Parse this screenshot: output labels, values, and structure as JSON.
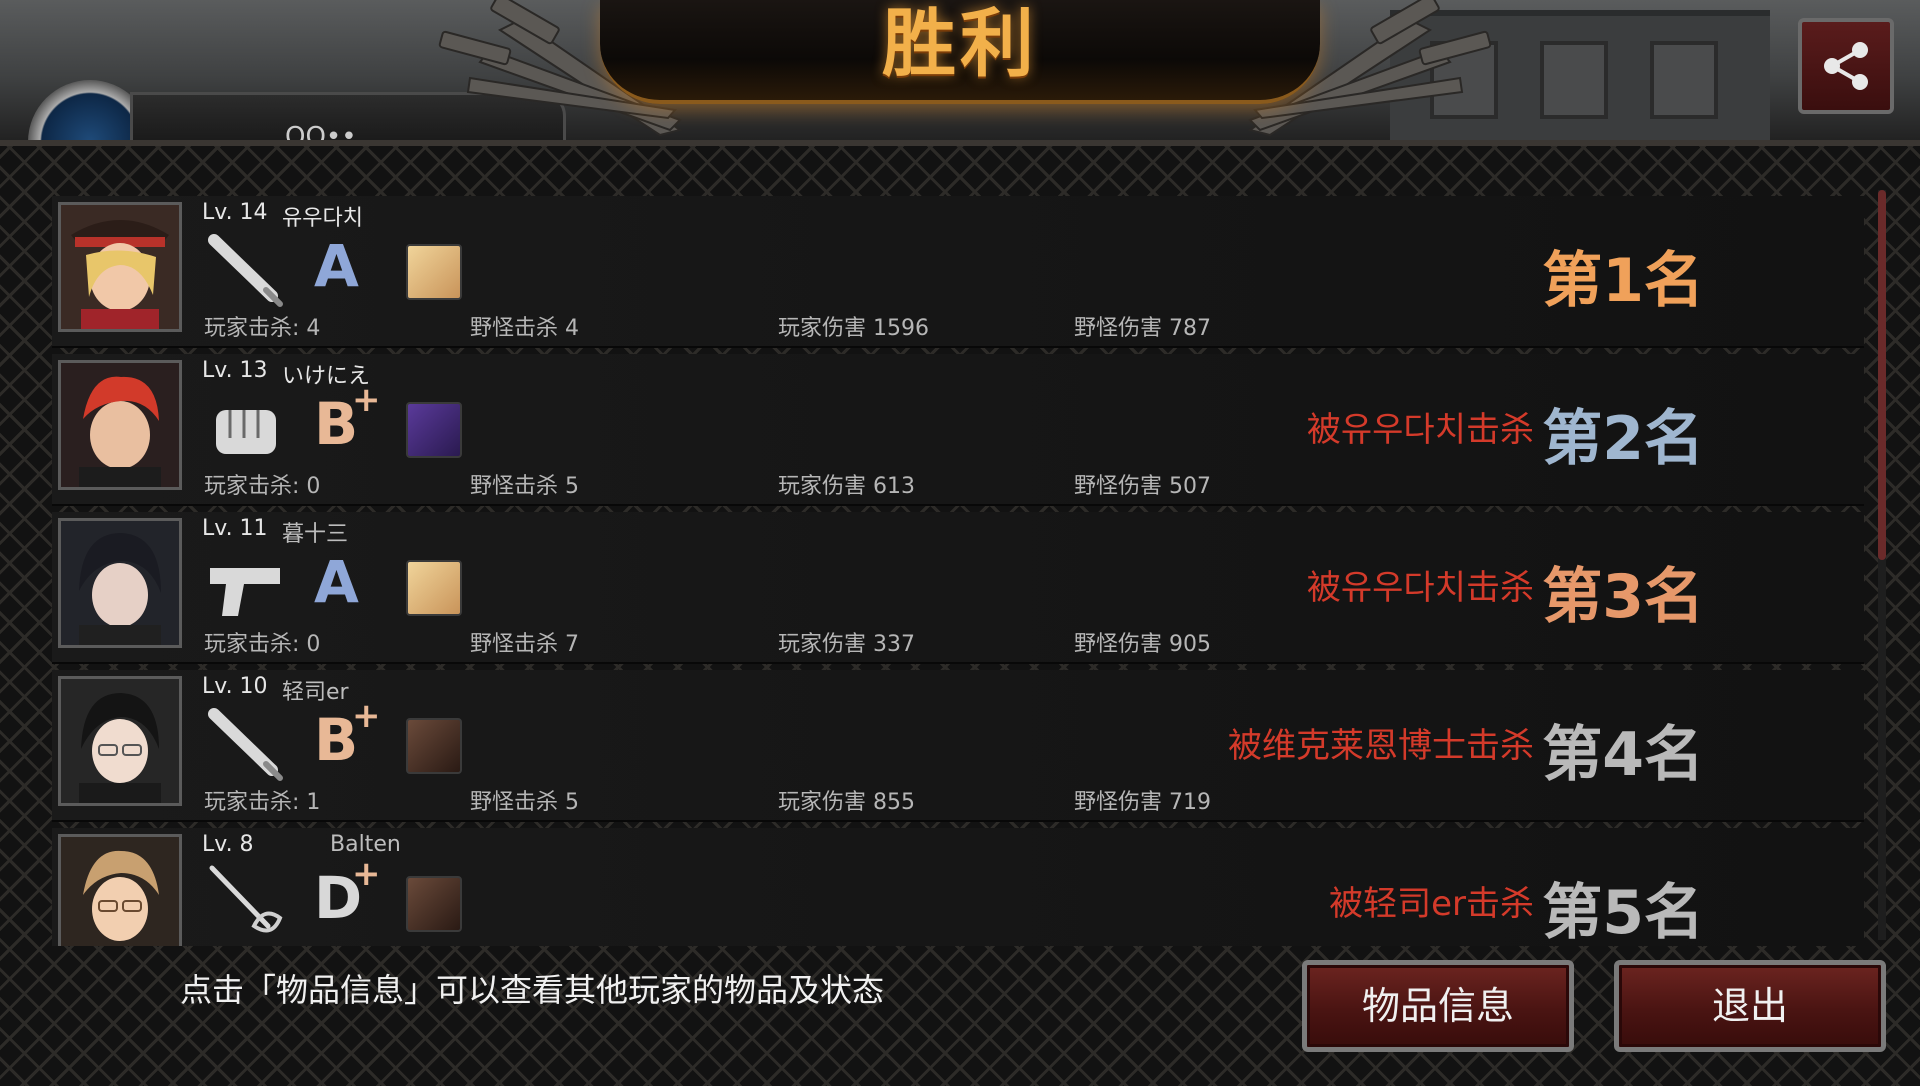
{
  "header": {
    "title": "胜利",
    "profile_name": "OO••"
  },
  "players": [
    {
      "level": "Lv. 14",
      "name": "유우다치",
      "weapon_icon": "bat-icon",
      "grade": "A",
      "grade_plus": "",
      "grade_color": "#8fa7d8",
      "item_icon": "crate-icon",
      "stats": {
        "player_kills": "玩家击杀: 4",
        "monster_kills": "野怪击杀 4",
        "player_damage": "玩家伤害 1596",
        "monster_damage": "野怪伤害 787"
      },
      "killed_by": "",
      "rank": "第1名",
      "rank_color": "#f0a15a"
    },
    {
      "level": "Lv. 13",
      "name": "いけにえ",
      "weapon_icon": "fist-icon",
      "grade": "B",
      "grade_plus": "+",
      "grade_color": "#e8b896",
      "item_icon": "purple-gear-icon",
      "stats": {
        "player_kills": "玩家击杀: 0",
        "monster_kills": "野怪击杀 5",
        "player_damage": "玩家伤害 613",
        "monster_damage": "野怪伤害 507"
      },
      "killed_by": "被유우다치击杀",
      "rank": "第2名",
      "rank_color": "#9fb6cf"
    },
    {
      "level": "Lv. 11",
      "name": "暮十三",
      "weapon_icon": "pistol-icon",
      "grade": "A",
      "grade_plus": "",
      "grade_color": "#8fa7d8",
      "item_icon": "crate-icon",
      "stats": {
        "player_kills": "玩家击杀: 0",
        "monster_kills": "野怪击杀 7",
        "player_damage": "玩家伤害 337",
        "monster_damage": "野怪伤害 905"
      },
      "killed_by": "被유우다치击杀",
      "rank": "第3名",
      "rank_color": "#e6986a"
    },
    {
      "level": "Lv. 10",
      "name": "轻司er",
      "weapon_icon": "bat-icon",
      "grade": "B",
      "grade_plus": "+",
      "grade_color": "#e8b896",
      "item_icon": "binoculars-icon",
      "stats": {
        "player_kills": "玩家击杀: 1",
        "monster_kills": "野怪击杀 5",
        "player_damage": "玩家伤害 855",
        "monster_damage": "野怪伤害 719"
      },
      "killed_by": "被维克莱恩博士击杀",
      "rank": "第4名",
      "rank_color": "#b9b9b9"
    },
    {
      "level": "Lv. 8",
      "name": "Balten",
      "weapon_icon": "rapier-icon",
      "grade": "D",
      "grade_plus": "+",
      "grade_color": "#d8d8d8",
      "item_icon": "binoculars-icon",
      "stats": {
        "player_kills": "",
        "monster_kills": "",
        "player_damage": "",
        "monster_damage": ""
      },
      "killed_by": "被轻司er击杀",
      "rank": "第5名",
      "rank_color": "#b9b9b9"
    }
  ],
  "footer": {
    "hint": "点击「物品信息」可以查看其他玩家的物品及状态",
    "item_info_label": "物品信息",
    "exit_label": "退出"
  },
  "colors": {
    "title": "#f2b04a",
    "killed_by": "#d43a2a",
    "button_bg": "#4a1412"
  }
}
